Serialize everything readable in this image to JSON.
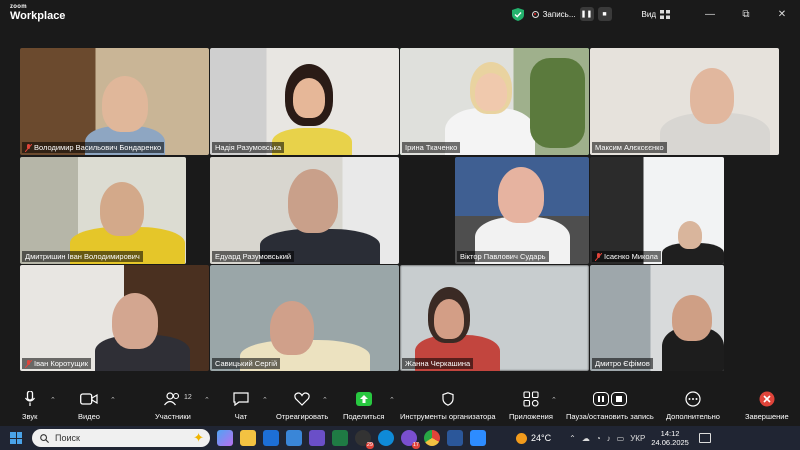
{
  "app": {
    "logo_small": "zoom",
    "logo_big": "Workplace"
  },
  "titlebar": {
    "recording_label": "Запись...",
    "view_label": "Вид",
    "minimize": "—",
    "restore": "⧉",
    "close": "✕"
  },
  "participants": [
    {
      "name": "Володимир Васильович Бондаренко",
      "muted": true
    },
    {
      "name": "Надія Разумовська",
      "muted": false
    },
    {
      "name": "Ірина Ткаченко",
      "muted": false,
      "active": true
    },
    {
      "name": "Максим Алєксєєнко",
      "muted": false
    },
    {
      "name": "Дмитришин Іван Володимирович",
      "muted": false
    },
    {
      "name": "Едуард Разумовський",
      "muted": false
    },
    {
      "name": "Віктор Павлович Сударь",
      "muted": false
    },
    {
      "name": "Ісаєнко Микола",
      "muted": true
    },
    {
      "name": "Іван Коротущик",
      "muted": true
    },
    {
      "name": "Савицький Сергій",
      "muted": false
    },
    {
      "name": "Жанна Черкашина",
      "muted": false
    },
    {
      "name": "Дмитро Єфімов",
      "muted": false
    }
  ],
  "toolbar": {
    "audio": "Звук",
    "video": "Видео",
    "participants": "Участники",
    "participants_count": "12",
    "chat": "Чат",
    "react": "Отреагировать",
    "share": "Поделиться",
    "host_tools": "Инструменты организатора",
    "apps": "Приложения",
    "pause_record": "Пауза/остановить запись",
    "more": "Дополнительно",
    "end": "Завершение"
  },
  "taskbar": {
    "search_placeholder": "Поиск",
    "badge_29": "29",
    "badge_17": "17",
    "temperature": "24°C",
    "language": "УКР",
    "time": "14:12",
    "date": "24.06.2025"
  },
  "colors": {
    "active_border": "#2ecc71",
    "end_red": "#e0443a",
    "share_green": "#28c840"
  }
}
